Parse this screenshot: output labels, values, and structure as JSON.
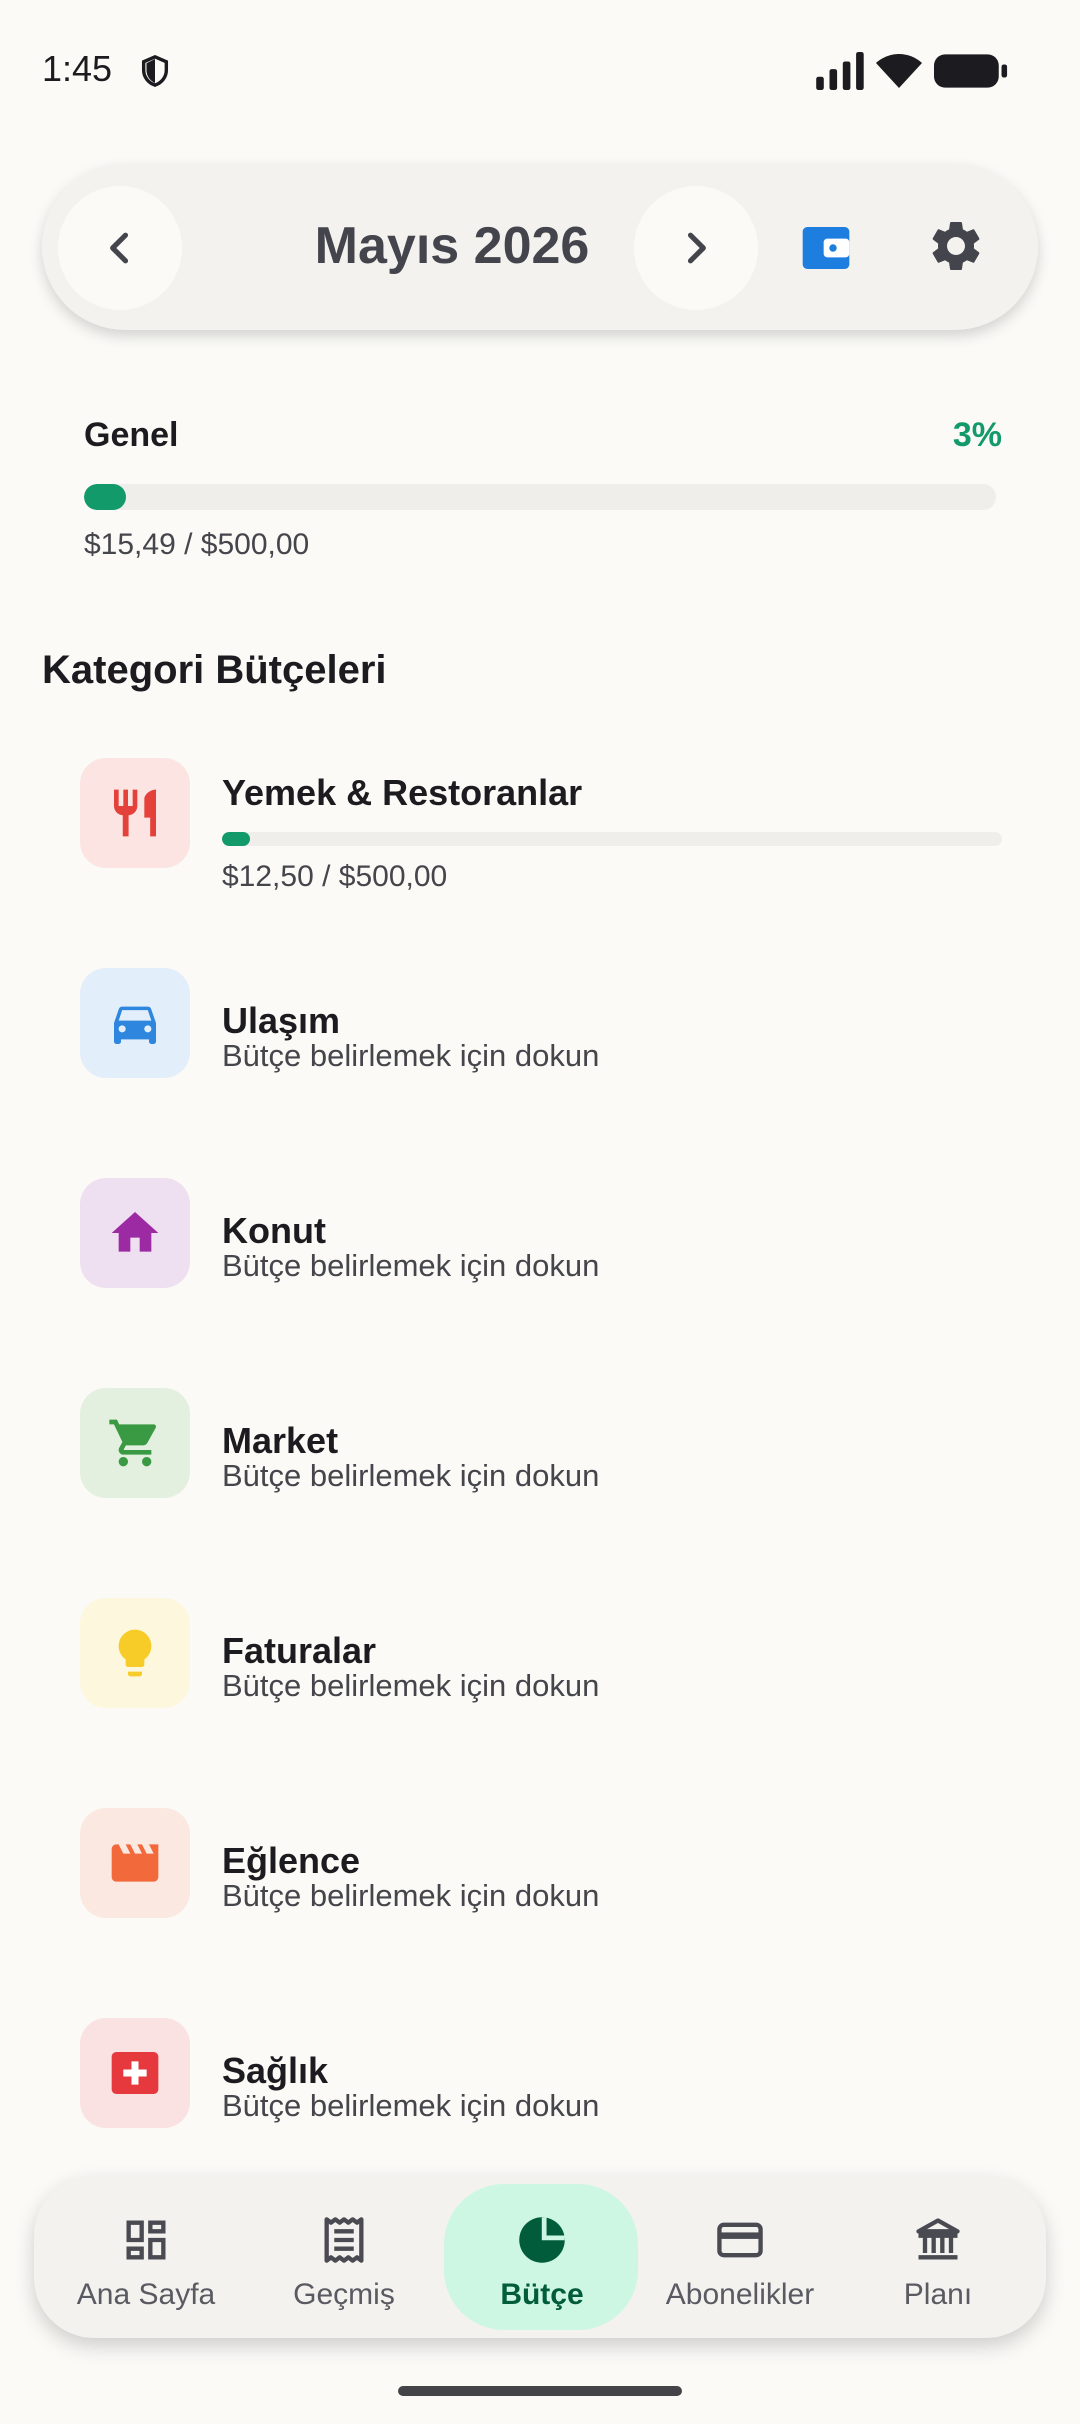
{
  "status_bar": {
    "time": "1:45",
    "icons": [
      "shield-icon",
      "signal-icon",
      "wifi-icon",
      "battery-icon"
    ]
  },
  "header": {
    "month_label": "Mayıs 2026",
    "prev_icon": "chevron-left-icon",
    "next_icon": "chevron-right-icon",
    "wallet_icon": "wallet-icon",
    "settings_icon": "gear-icon"
  },
  "overall": {
    "label": "Genel",
    "percent_text": "3%",
    "progress_fraction": 0.03,
    "amount_text": "$15,49 / $500,00",
    "accent": "#139a6b"
  },
  "section_title": "Kategori Bütçeleri",
  "categories": [
    {
      "name": "Yemek & Restoranlar",
      "icon": "restaurant-icon",
      "bg": "#fbe4e2",
      "fg": "#e5413b",
      "amount": "$12,50 / $500,00",
      "progress_fraction": 0.025
    },
    {
      "name": "Ulaşım",
      "subtitle": "Bütçe belirlemek için dokun",
      "icon": "car-icon",
      "bg": "#e2eefa",
      "fg": "#2f86de"
    },
    {
      "name": "Konut",
      "subtitle": "Bütçe belirlemek için dokun",
      "icon": "home-icon",
      "bg": "#efe0f1",
      "fg": "#9b2aa3"
    },
    {
      "name": "Market",
      "subtitle": "Bütçe belirlemek için dokun",
      "icon": "cart-icon",
      "bg": "#e3f0df",
      "fg": "#3a9a44"
    },
    {
      "name": "Faturalar",
      "subtitle": "Bütçe belirlemek için dokun",
      "icon": "lightbulb-icon",
      "bg": "#fdf7dd",
      "fg": "#f7cc28"
    },
    {
      "name": "Eğlence",
      "subtitle": "Bütçe belirlemek için dokun",
      "icon": "clapperboard-icon",
      "bg": "#fbe8e0",
      "fg": "#f26a3c"
    },
    {
      "name": "Sağlık",
      "subtitle": "Bütçe belirlemek için dokun",
      "icon": "medical-cross-icon",
      "bg": "#fbe2e2",
      "fg": "#e6393d"
    }
  ],
  "nav": {
    "items": [
      {
        "label": "Ana Sayfa",
        "icon": "dashboard-icon"
      },
      {
        "label": "Geçmiş",
        "icon": "receipt-icon"
      },
      {
        "label": "Bütçe",
        "icon": "pie-chart-icon",
        "active": true
      },
      {
        "label": "Abonelikler",
        "icon": "credit-card-icon"
      },
      {
        "label": "Planı",
        "icon": "bank-icon"
      }
    ]
  }
}
